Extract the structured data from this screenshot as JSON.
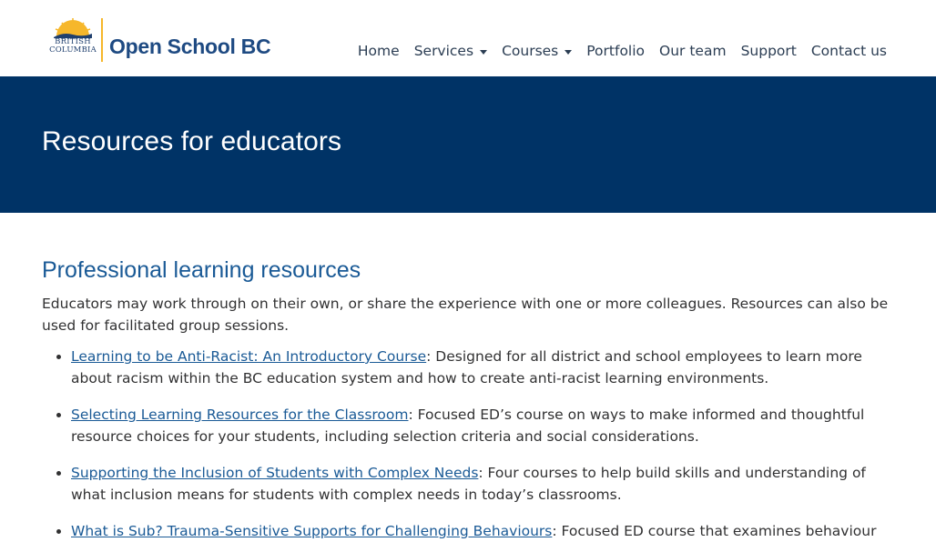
{
  "logo": {
    "province_line1": "BRITISH",
    "province_line2": "COLUMBIA",
    "name": "Open School BC"
  },
  "nav": {
    "items": [
      {
        "label": "Home",
        "dropdown": false
      },
      {
        "label": "Services",
        "dropdown": true
      },
      {
        "label": "Courses",
        "dropdown": true
      },
      {
        "label": "Portfolio",
        "dropdown": false
      },
      {
        "label": "Our team",
        "dropdown": false
      },
      {
        "label": "Support",
        "dropdown": false
      },
      {
        "label": "Contact us",
        "dropdown": false
      }
    ]
  },
  "banner": {
    "title": "Resources for educators"
  },
  "section": {
    "heading": "Professional learning resources",
    "intro": "Educators may work through on their own, or share the experience with one or more colleagues. Resources can also be used for facilitated group sessions.",
    "resources": [
      {
        "link": "Learning to be Anti-Racist: An Introductory Course",
        "desc": ": Designed for all district and school employees to learn more about racism within the BC education system and how to create anti-racist learning environments."
      },
      {
        "link": "Selecting Learning Resources for the Classroom",
        "desc": ": Focused ED’s course on ways to make informed and thoughtful resource choices for your students, including selection criteria and social considerations."
      },
      {
        "link": "Supporting the Inclusion of Students with Complex Needs",
        "desc": ": Four courses to help build skills and understanding of what inclusion means for students with complex needs in today’s classrooms."
      },
      {
        "link": "What is Sub? Trauma-Sensitive Supports for Challenging Behaviours",
        "desc": ": Focused ED course that examines behaviour"
      }
    ]
  },
  "colors": {
    "banner_bg": "#003366",
    "link": "#1a5a96",
    "heading": "#1a5a96",
    "logo_accent": "#f6b72b"
  }
}
